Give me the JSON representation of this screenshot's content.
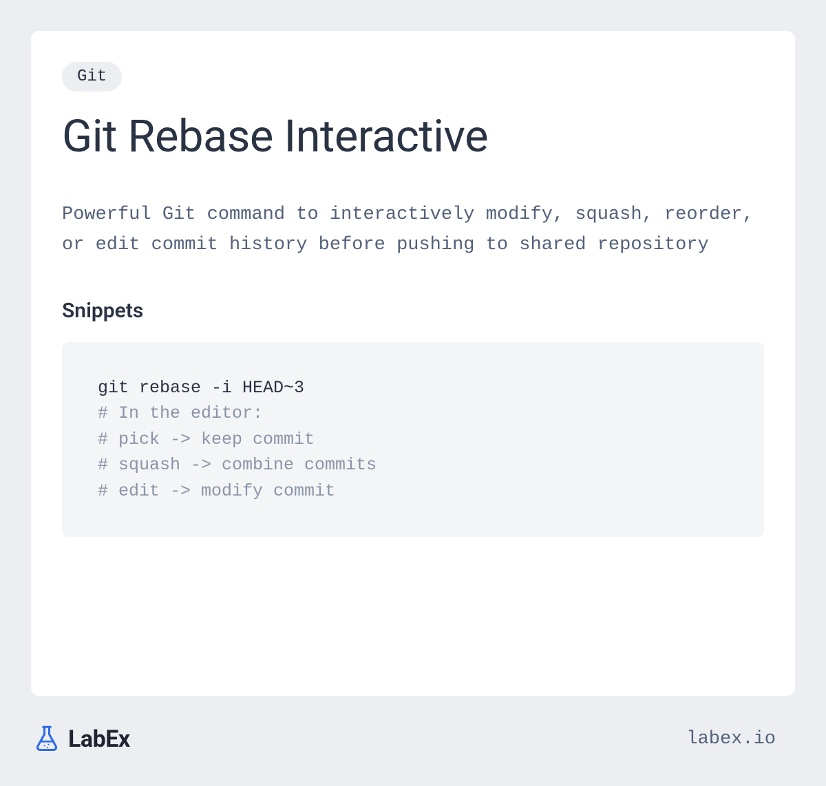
{
  "card": {
    "tag": "Git",
    "title": "Git Rebase Interactive",
    "description": "Powerful Git command to interactively modify, squash, reorder, or edit commit history before pushing to shared repository",
    "snippets_heading": "Snippets",
    "snippet": {
      "command": "git rebase -i HEAD~3",
      "comments": [
        "# In the editor:",
        "# pick -> keep commit",
        "# squash -> combine commits",
        "# edit -> modify commit"
      ]
    }
  },
  "footer": {
    "logo_text": "LabEx",
    "url": "labex.io"
  }
}
